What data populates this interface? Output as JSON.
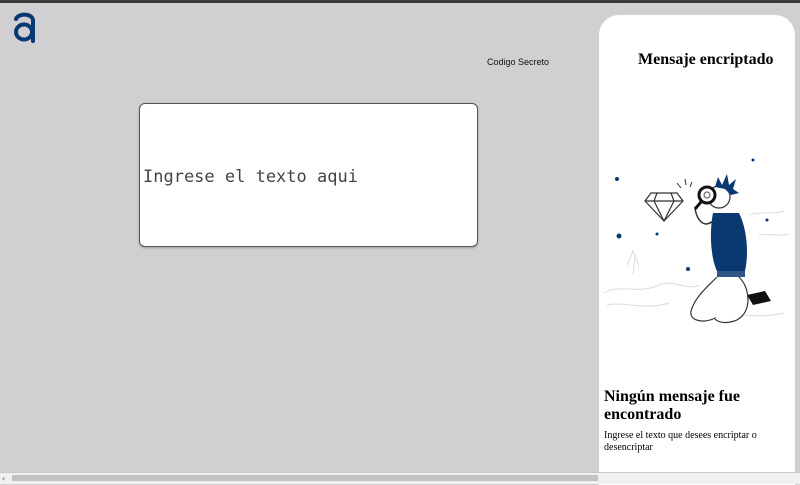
{
  "header": {
    "logo_icon": "letter-a-logo",
    "code_label": "Codigo Secreto"
  },
  "input": {
    "placeholder": "Ingrese el texto aqui"
  },
  "output_panel": {
    "title": "Mensaje encriptado",
    "illustration": "person-with-magnifier-and-diamond",
    "empty_title": "Ningún mensaje fue encontrado",
    "empty_description": "Ingrese el texto que desees encriptar o desencriptar"
  },
  "colors": {
    "background": "#d0cfd1",
    "brand": "#0a3871",
    "panel": "#ffffff"
  }
}
